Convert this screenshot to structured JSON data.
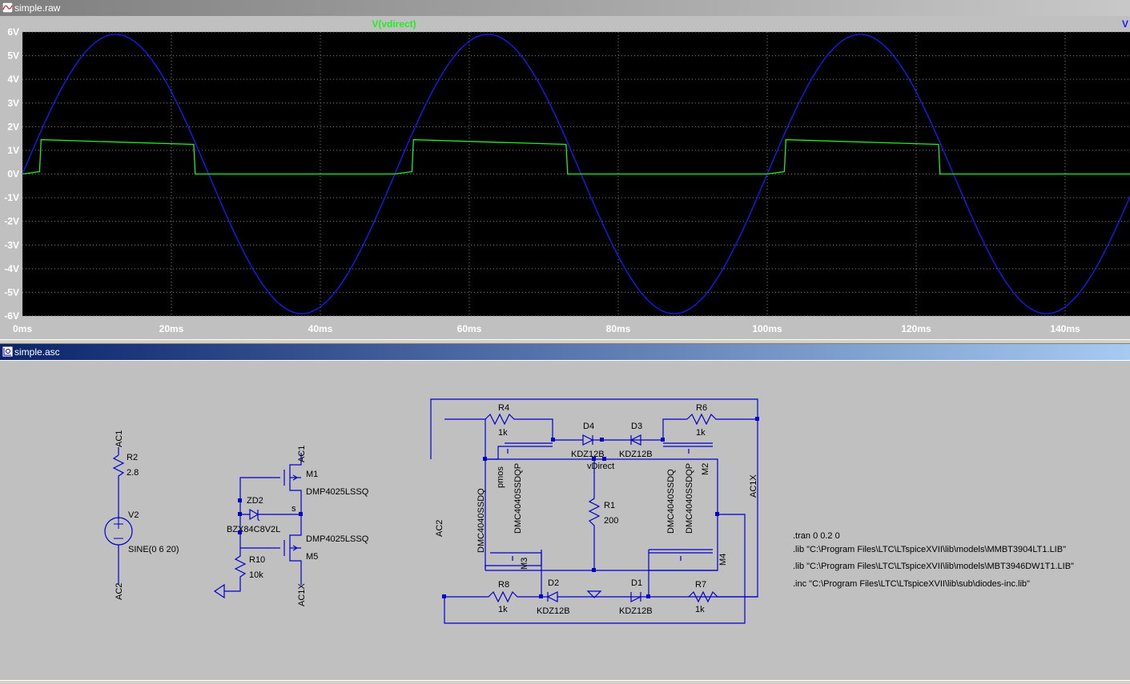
{
  "windows": {
    "plot_title": "simple.raw",
    "schematic_title": "simple.asc"
  },
  "plot": {
    "trace_label": "V(vdirect)",
    "trace_label_right": "V",
    "colors": {
      "background": "#000000",
      "grid": "#808080",
      "trace_vdirect": "#22ee22",
      "trace_source": "#1a1aff",
      "axis_text": "#ffffff",
      "title_text": "#22ee22"
    }
  },
  "chart_data": {
    "type": "line",
    "title": "",
    "xlabel": "",
    "ylabel": "",
    "xlim": [
      0,
      150
    ],
    "ylim": [
      -6,
      6
    ],
    "x_unit": "ms",
    "y_unit": "V",
    "x_ticks": [
      "0ms",
      "20ms",
      "40ms",
      "60ms",
      "80ms",
      "100ms",
      "120ms",
      "140ms"
    ],
    "y_ticks": [
      "6V",
      "5V",
      "4V",
      "3V",
      "2V",
      "1V",
      "0V",
      "-1V",
      "-2V",
      "-3V",
      "-4V",
      "-5V",
      "-6V"
    ],
    "grid": true,
    "series": [
      {
        "name": "V(vdirect)",
        "x": [
          0,
          2.3,
          2.5,
          23,
          23.2,
          25,
          50,
          52.3,
          52.5,
          73,
          73.2,
          75,
          100,
          102.3,
          102.5,
          123,
          123.2,
          125,
          150
        ],
        "y": [
          0,
          0.1,
          1.45,
          1.25,
          0,
          0,
          0,
          0.1,
          1.45,
          1.25,
          0,
          0,
          0,
          0.1,
          1.45,
          1.25,
          0,
          0,
          0
        ]
      },
      {
        "name": "",
        "function": "sine",
        "offset": 0,
        "amplitude": 5.9,
        "frequency_hz": 20,
        "x_range": [
          0,
          150
        ]
      }
    ]
  },
  "schematic": {
    "source": {
      "top_node": "AC1",
      "resistor_name": "R2",
      "resistor_value": "2.8",
      "name": "V2",
      "value": "SINE(0 6 20)",
      "bottom_node": "AC2"
    },
    "switch": {
      "node_top": "AC1",
      "m1": "M1",
      "m1_model": "DMP4025LSSQ",
      "zener": "ZD2",
      "zener_model": "BZX84C8V2L",
      "s_node": "s",
      "m5_model": "DMP4025LSSQ",
      "m5": "M5",
      "r10": "R10",
      "r10_value": "10k",
      "node_bottom": "AC1X"
    },
    "bridge": {
      "r4": "R4",
      "r4_value": "1k",
      "d4": "D4",
      "d4_model": "KDZ12B",
      "d3": "D3",
      "d3_model": "KDZ12B",
      "r6": "R6",
      "r6_value": "1k",
      "vdirect": "vDirect",
      "pmos": "pmos",
      "left_mos_a": "DMC4040SSDQ",
      "left_mos_b": "DMC4040SSDQP",
      "right_mos_a": "DMC4040SSDQ",
      "right_mos_b": "DMC4040SSDQP",
      "m2": "M2",
      "m3": "M3",
      "m4": "M4",
      "r1": "R1",
      "r1_value": "200",
      "ac2": "AC2",
      "ac1x": "AC1X",
      "r8": "R8",
      "r8_value": "1k",
      "d2": "D2",
      "d2_model": "KDZ12B",
      "d1": "D1",
      "d1_model": "KDZ12B",
      "r7": "R7",
      "r7_value": "1k"
    },
    "directives": [
      ".tran 0 0.2 0",
      ".lib \"C:\\Program Files\\LTC\\LTspiceXVII\\lib\\models\\MMBT3904LT1.LIB\"",
      ".lib \"C:\\Program Files\\LTC\\LTspiceXVII\\lib\\models\\MBT3946DW1T1.LIB\"",
      ".inc \"C:\\Program Files\\LTC\\LTspiceXVII\\lib\\sub\\diodes-inc.lib\""
    ],
    "colors": {
      "wire": "#0000cc",
      "text": "#000000"
    }
  }
}
